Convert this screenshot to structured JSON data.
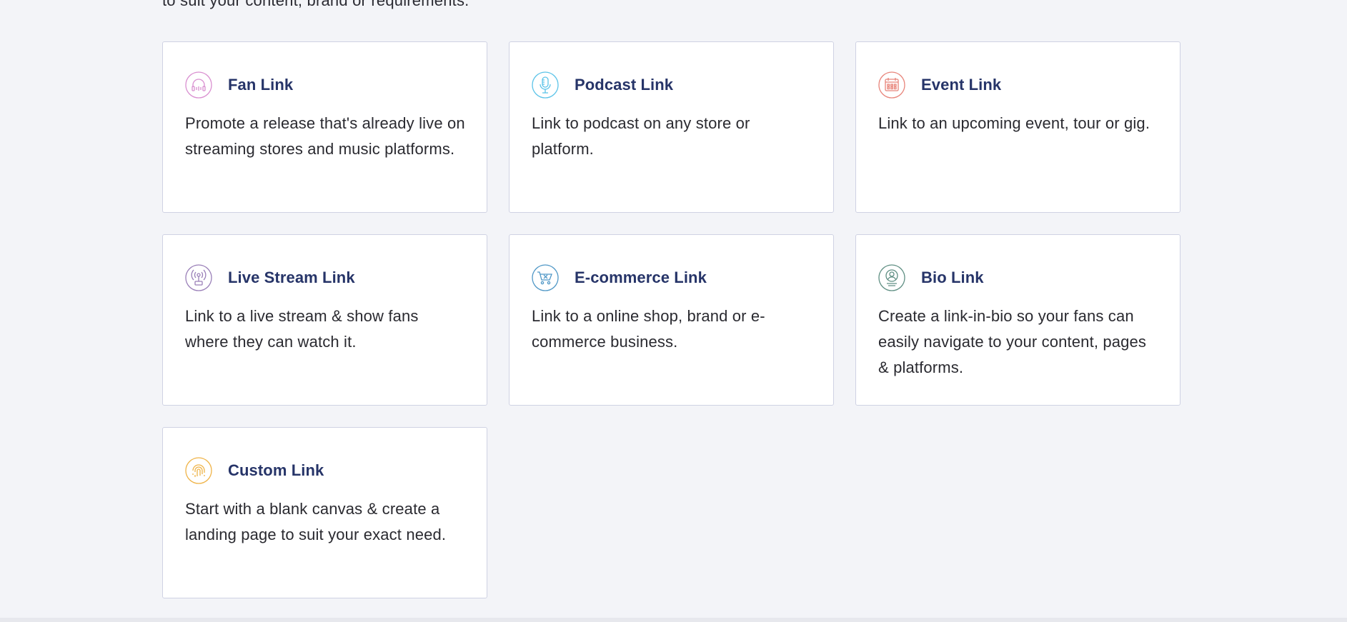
{
  "intro_text": "to suit your content, brand or requirements.",
  "cards": [
    {
      "title": "Fan Link",
      "description": "Promote a release that's already live on streaming stores and music platforms.",
      "icon": "headphones-icon",
      "color": "#d98fd0"
    },
    {
      "title": "Podcast Link",
      "description": "Link to podcast on any store or platform.",
      "icon": "microphone-icon",
      "color": "#5bc3e8"
    },
    {
      "title": "Event Link",
      "description": "Link to an upcoming event, tour or gig.",
      "icon": "calendar-icon",
      "color": "#e8847a"
    },
    {
      "title": "Live Stream Link",
      "description": "Link to a live stream & show fans where they can watch it.",
      "icon": "broadcast-icon",
      "color": "#9a7fb8"
    },
    {
      "title": "E-commerce Link",
      "description": "Link to a online shop, brand or e-commerce business.",
      "icon": "shopping-cart-icon",
      "color": "#4f97c6"
    },
    {
      "title": "Bio Link",
      "description": "Create a link-in-bio so your fans can easily navigate to your content, pages & platforms.",
      "icon": "profile-icon",
      "color": "#5f8f83"
    },
    {
      "title": "Custom Link",
      "description": "Start with a blank canvas & create a landing page to suit your exact need.",
      "icon": "fingerprint-icon",
      "color": "#efb347"
    }
  ]
}
